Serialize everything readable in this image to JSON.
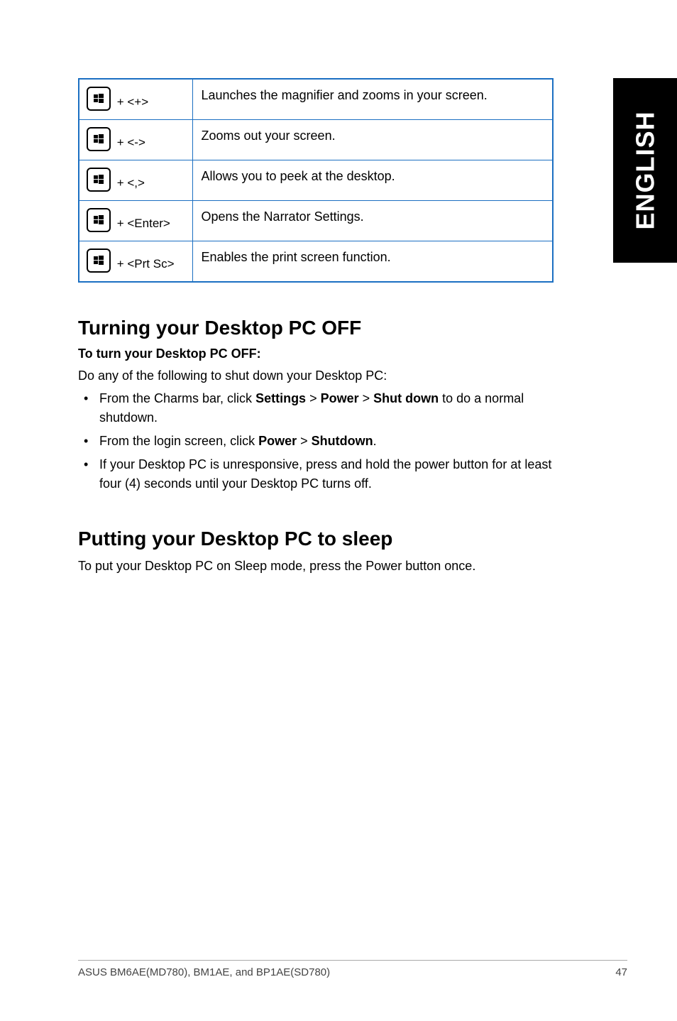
{
  "side_tab": "ENGLISH",
  "table": {
    "rows": [
      {
        "combo": " + <+>",
        "desc": "Launches the magnifier and zooms in your screen."
      },
      {
        "combo": " + <->",
        "desc": "Zooms out your screen."
      },
      {
        "combo": " + <,>",
        "desc": "Allows you to peek at the desktop."
      },
      {
        "combo": " + <Enter>",
        "desc": "Opens the Narrator Settings."
      },
      {
        "combo": " + <Prt Sc>",
        "desc": "Enables the print screen function."
      }
    ]
  },
  "section_off": {
    "heading": "Turning your Desktop PC OFF",
    "sub": "To turn your Desktop PC OFF:",
    "intro": "Do any of the following to shut down your Desktop PC:",
    "bullet1_pre": "From the Charms bar, click ",
    "bullet1_b1": "Settings",
    "bullet1_gt1": " > ",
    "bullet1_b2": "Power",
    "bullet1_gt2": " > ",
    "bullet1_b3": "Shut down",
    "bullet1_post": " to do a normal shutdown.",
    "bullet2_pre": "From the login screen, click ",
    "bullet2_b1": "Power",
    "bullet2_gt": " > ",
    "bullet2_b2": "Shutdown",
    "bullet2_post": ".",
    "bullet3": "If your Desktop PC is unresponsive, press and hold the power  button for at least four (4) seconds until your Desktop PC turns off."
  },
  "section_sleep": {
    "heading": "Putting your Desktop PC to sleep",
    "body": "To put your Desktop PC on Sleep mode, press the Power button once."
  },
  "footer": {
    "left": "ASUS BM6AE(MD780), BM1AE, and BP1AE(SD780)",
    "right": "47"
  }
}
